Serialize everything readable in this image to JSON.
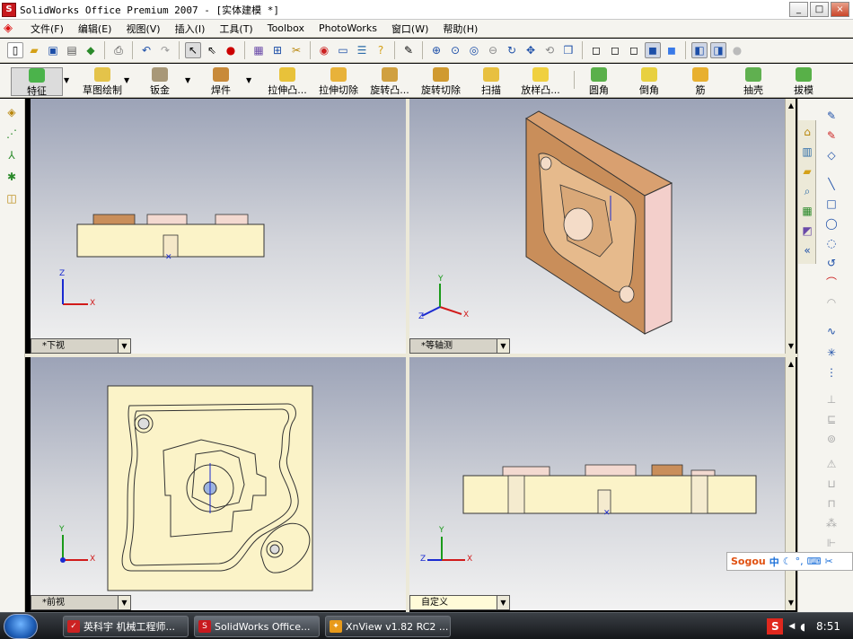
{
  "window": {
    "title": "SolidWorks Office Premium 2007 - [实体建模 *]",
    "controls": [
      "_",
      "□",
      "×"
    ]
  },
  "menu": {
    "items": [
      "文件(F)",
      "编辑(E)",
      "视图(V)",
      "插入(I)",
      "工具(T)",
      "Toolbox",
      "PhotoWorks",
      "窗口(W)",
      "帮助(H)"
    ]
  },
  "features": {
    "items": [
      "特征",
      "草图绘制",
      "钣金",
      "焊件",
      "拉伸凸...",
      "拉伸切除",
      "旋转凸...",
      "旋转切除",
      "扫描",
      "放样凸...",
      "圆角",
      "倒角",
      "筋",
      "抽壳",
      "拔模"
    ]
  },
  "views": {
    "top_left": "*下视",
    "top_right": "*等轴测",
    "bottom_left": "*前视",
    "bottom_right": "自定义"
  },
  "axes": {
    "x": "X",
    "y": "Y",
    "z": "Z"
  },
  "ime": {
    "brand": "Sogou",
    "mode": "中"
  },
  "taskbar": {
    "tasks": [
      "英科宇 机械工程师...",
      "SolidWorks Office...",
      "XnView v1.82 RC2 ..."
    ],
    "tray_s": "S",
    "clock": "8:51"
  },
  "colors": {
    "part_face": "#fbf3c8",
    "part_edge": "#333333",
    "iso_copper": "#c98e5a",
    "iso_side": "#f3cfcb",
    "axis_x": "#d11a1a",
    "axis_y": "#1a9a1a",
    "axis_z": "#1a2ad1"
  },
  "icons": {
    "toolbar": [
      "new-icon",
      "open-icon",
      "save-icon",
      "print-icon",
      "undo-icon",
      "redo-icon",
      "select-icon",
      "zoom-icon",
      "rotate-icon",
      "pan-icon",
      "view-orientation-icon",
      "display-style-icon"
    ]
  }
}
